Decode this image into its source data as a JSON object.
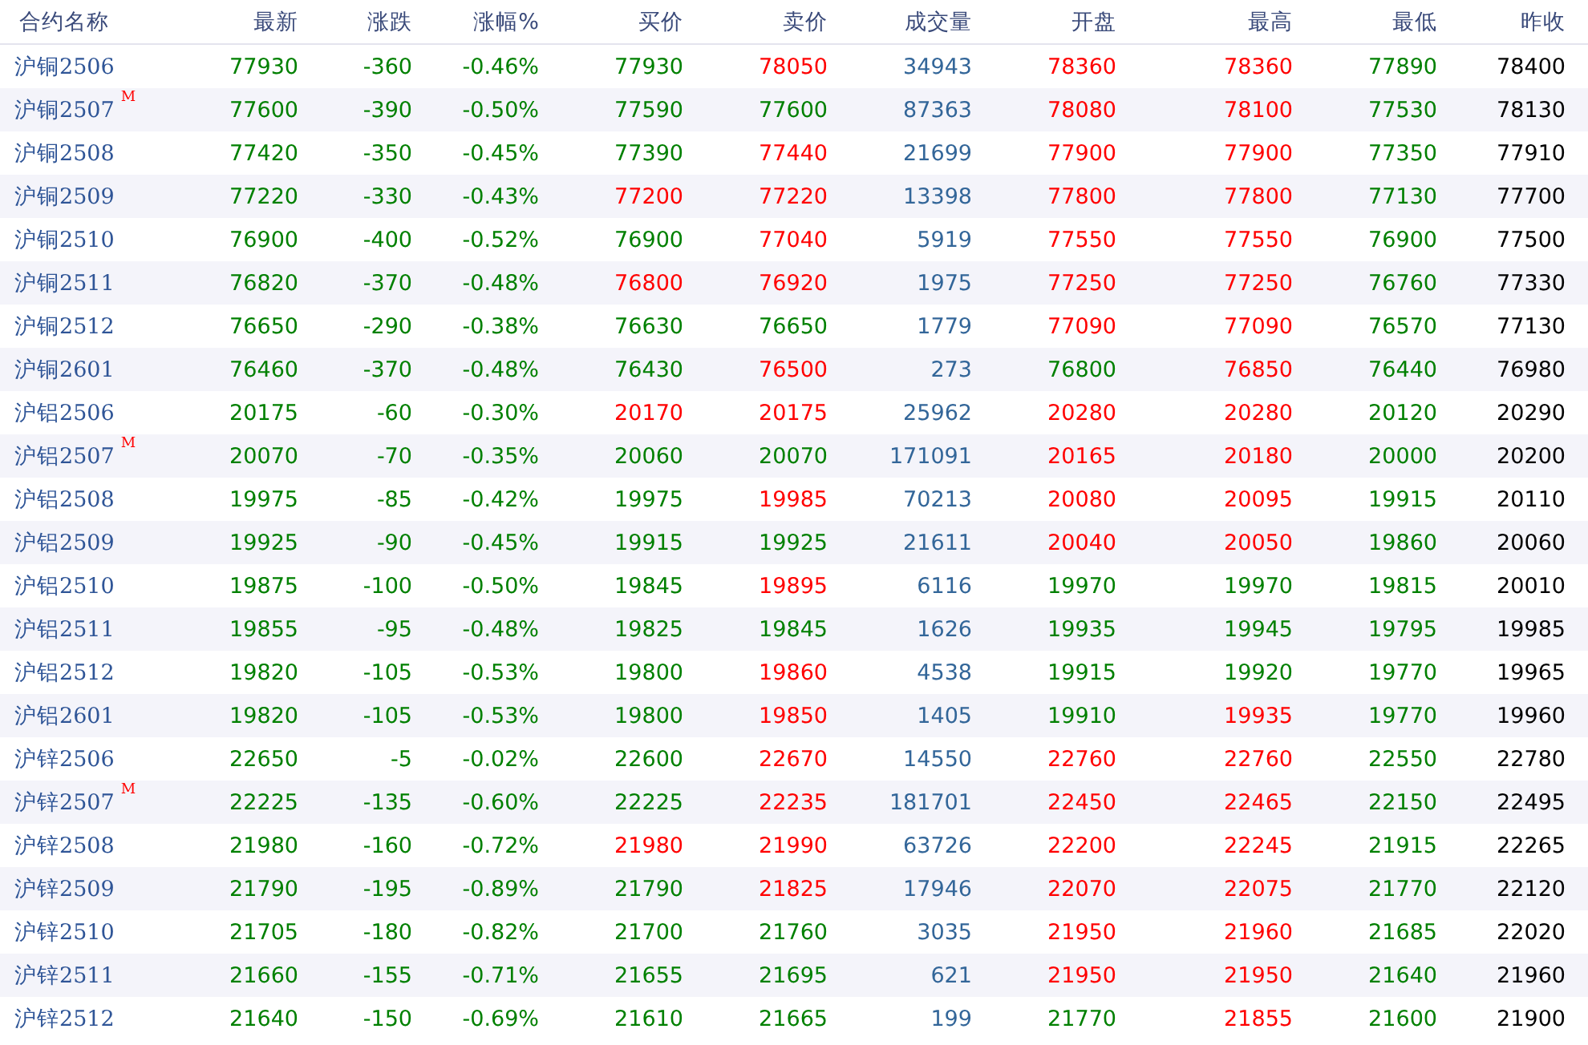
{
  "columns": [
    {
      "label": "合约名称",
      "kind": "name"
    },
    {
      "label": "最新",
      "kind": "trend"
    },
    {
      "label": "涨跌",
      "kind": "trend"
    },
    {
      "label": "涨幅%",
      "kind": "trend"
    },
    {
      "label": "买价",
      "kind": "trend"
    },
    {
      "label": "卖价",
      "kind": "trend"
    },
    {
      "label": "成交量",
      "kind": "volume"
    },
    {
      "label": "开盘",
      "kind": "trend"
    },
    {
      "label": "最高",
      "kind": "trend"
    },
    {
      "label": "最低",
      "kind": "trend"
    },
    {
      "label": "昨收",
      "kind": "plain"
    }
  ],
  "rows": [
    {
      "name": "沪铜2506",
      "cells": [
        {
          "text": "77930",
          "rising": false
        },
        {
          "text": "-360",
          "rising": false
        },
        {
          "text": "-0.46%",
          "rising": false
        },
        {
          "text": "77930",
          "rising": false
        },
        {
          "text": "78050",
          "rising": true
        },
        {
          "text": "34943"
        },
        {
          "text": "78360",
          "rising": true
        },
        {
          "text": "78360",
          "rising": true
        },
        {
          "text": "77890",
          "rising": false
        },
        {
          "text": "78400"
        }
      ]
    },
    {
      "name": "沪铜2507",
      "badge": "M",
      "cells": [
        {
          "text": "77600",
          "rising": false
        },
        {
          "text": "-390",
          "rising": false
        },
        {
          "text": "-0.50%",
          "rising": false
        },
        {
          "text": "77590",
          "rising": false
        },
        {
          "text": "77600",
          "rising": false
        },
        {
          "text": "87363"
        },
        {
          "text": "78080",
          "rising": true
        },
        {
          "text": "78100",
          "rising": true
        },
        {
          "text": "77530",
          "rising": false
        },
        {
          "text": "78130"
        }
      ]
    },
    {
      "name": "沪铜2508",
      "cells": [
        {
          "text": "77420",
          "rising": false
        },
        {
          "text": "-350",
          "rising": false
        },
        {
          "text": "-0.45%",
          "rising": false
        },
        {
          "text": "77390",
          "rising": false
        },
        {
          "text": "77440",
          "rising": true
        },
        {
          "text": "21699"
        },
        {
          "text": "77900",
          "rising": true
        },
        {
          "text": "77900",
          "rising": true
        },
        {
          "text": "77350",
          "rising": false
        },
        {
          "text": "77910"
        }
      ]
    },
    {
      "name": "沪铜2509",
      "cells": [
        {
          "text": "77220",
          "rising": false
        },
        {
          "text": "-330",
          "rising": false
        },
        {
          "text": "-0.43%",
          "rising": false
        },
        {
          "text": "77200",
          "rising": true
        },
        {
          "text": "77220",
          "rising": true
        },
        {
          "text": "13398"
        },
        {
          "text": "77800",
          "rising": true
        },
        {
          "text": "77800",
          "rising": true
        },
        {
          "text": "77130",
          "rising": false
        },
        {
          "text": "77700"
        }
      ]
    },
    {
      "name": "沪铜2510",
      "cells": [
        {
          "text": "76900",
          "rising": false
        },
        {
          "text": "-400",
          "rising": false
        },
        {
          "text": "-0.52%",
          "rising": false
        },
        {
          "text": "76900",
          "rising": false
        },
        {
          "text": "77040",
          "rising": true
        },
        {
          "text": "5919"
        },
        {
          "text": "77550",
          "rising": true
        },
        {
          "text": "77550",
          "rising": true
        },
        {
          "text": "76900",
          "rising": false
        },
        {
          "text": "77500"
        }
      ]
    },
    {
      "name": "沪铜2511",
      "cells": [
        {
          "text": "76820",
          "rising": false
        },
        {
          "text": "-370",
          "rising": false
        },
        {
          "text": "-0.48%",
          "rising": false
        },
        {
          "text": "76800",
          "rising": true
        },
        {
          "text": "76920",
          "rising": true
        },
        {
          "text": "1975"
        },
        {
          "text": "77250",
          "rising": true
        },
        {
          "text": "77250",
          "rising": true
        },
        {
          "text": "76760",
          "rising": false
        },
        {
          "text": "77330"
        }
      ]
    },
    {
      "name": "沪铜2512",
      "cells": [
        {
          "text": "76650",
          "rising": false
        },
        {
          "text": "-290",
          "rising": false
        },
        {
          "text": "-0.38%",
          "rising": false
        },
        {
          "text": "76630",
          "rising": false
        },
        {
          "text": "76650",
          "rising": false
        },
        {
          "text": "1779"
        },
        {
          "text": "77090",
          "rising": true
        },
        {
          "text": "77090",
          "rising": true
        },
        {
          "text": "76570",
          "rising": false
        },
        {
          "text": "77130"
        }
      ]
    },
    {
      "name": "沪铜2601",
      "cells": [
        {
          "text": "76460",
          "rising": false
        },
        {
          "text": "-370",
          "rising": false
        },
        {
          "text": "-0.48%",
          "rising": false
        },
        {
          "text": "76430",
          "rising": false
        },
        {
          "text": "76500",
          "rising": true
        },
        {
          "text": "273"
        },
        {
          "text": "76800",
          "rising": false
        },
        {
          "text": "76850",
          "rising": true
        },
        {
          "text": "76440",
          "rising": false
        },
        {
          "text": "76980"
        }
      ]
    },
    {
      "name": "沪铝2506",
      "cells": [
        {
          "text": "20175",
          "rising": false
        },
        {
          "text": "-60",
          "rising": false
        },
        {
          "text": "-0.30%",
          "rising": false
        },
        {
          "text": "20170",
          "rising": true
        },
        {
          "text": "20175",
          "rising": true
        },
        {
          "text": "25962"
        },
        {
          "text": "20280",
          "rising": true
        },
        {
          "text": "20280",
          "rising": true
        },
        {
          "text": "20120",
          "rising": false
        },
        {
          "text": "20290"
        }
      ]
    },
    {
      "name": "沪铝2507",
      "badge": "M",
      "cells": [
        {
          "text": "20070",
          "rising": false
        },
        {
          "text": "-70",
          "rising": false
        },
        {
          "text": "-0.35%",
          "rising": false
        },
        {
          "text": "20060",
          "rising": false
        },
        {
          "text": "20070",
          "rising": false
        },
        {
          "text": "171091"
        },
        {
          "text": "20165",
          "rising": true
        },
        {
          "text": "20180",
          "rising": true
        },
        {
          "text": "20000",
          "rising": false
        },
        {
          "text": "20200"
        }
      ]
    },
    {
      "name": "沪铝2508",
      "cells": [
        {
          "text": "19975",
          "rising": false
        },
        {
          "text": "-85",
          "rising": false
        },
        {
          "text": "-0.42%",
          "rising": false
        },
        {
          "text": "19975",
          "rising": false
        },
        {
          "text": "19985",
          "rising": true
        },
        {
          "text": "70213"
        },
        {
          "text": "20080",
          "rising": true
        },
        {
          "text": "20095",
          "rising": true
        },
        {
          "text": "19915",
          "rising": false
        },
        {
          "text": "20110"
        }
      ]
    },
    {
      "name": "沪铝2509",
      "cells": [
        {
          "text": "19925",
          "rising": false
        },
        {
          "text": "-90",
          "rising": false
        },
        {
          "text": "-0.45%",
          "rising": false
        },
        {
          "text": "19915",
          "rising": false
        },
        {
          "text": "19925",
          "rising": false
        },
        {
          "text": "21611"
        },
        {
          "text": "20040",
          "rising": true
        },
        {
          "text": "20050",
          "rising": true
        },
        {
          "text": "19860",
          "rising": false
        },
        {
          "text": "20060"
        }
      ]
    },
    {
      "name": "沪铝2510",
      "cells": [
        {
          "text": "19875",
          "rising": false
        },
        {
          "text": "-100",
          "rising": false
        },
        {
          "text": "-0.50%",
          "rising": false
        },
        {
          "text": "19845",
          "rising": false
        },
        {
          "text": "19895",
          "rising": true
        },
        {
          "text": "6116"
        },
        {
          "text": "19970",
          "rising": false
        },
        {
          "text": "19970",
          "rising": false
        },
        {
          "text": "19815",
          "rising": false
        },
        {
          "text": "20010"
        }
      ]
    },
    {
      "name": "沪铝2511",
      "cells": [
        {
          "text": "19855",
          "rising": false
        },
        {
          "text": "-95",
          "rising": false
        },
        {
          "text": "-0.48%",
          "rising": false
        },
        {
          "text": "19825",
          "rising": false
        },
        {
          "text": "19845",
          "rising": false
        },
        {
          "text": "1626"
        },
        {
          "text": "19935",
          "rising": false
        },
        {
          "text": "19945",
          "rising": false
        },
        {
          "text": "19795",
          "rising": false
        },
        {
          "text": "19985"
        }
      ]
    },
    {
      "name": "沪铝2512",
      "cells": [
        {
          "text": "19820",
          "rising": false
        },
        {
          "text": "-105",
          "rising": false
        },
        {
          "text": "-0.53%",
          "rising": false
        },
        {
          "text": "19800",
          "rising": false
        },
        {
          "text": "19860",
          "rising": true
        },
        {
          "text": "4538"
        },
        {
          "text": "19915",
          "rising": false
        },
        {
          "text": "19920",
          "rising": false
        },
        {
          "text": "19770",
          "rising": false
        },
        {
          "text": "19965"
        }
      ]
    },
    {
      "name": "沪铝2601",
      "cells": [
        {
          "text": "19820",
          "rising": false
        },
        {
          "text": "-105",
          "rising": false
        },
        {
          "text": "-0.53%",
          "rising": false
        },
        {
          "text": "19800",
          "rising": false
        },
        {
          "text": "19850",
          "rising": true
        },
        {
          "text": "1405"
        },
        {
          "text": "19910",
          "rising": false
        },
        {
          "text": "19935",
          "rising": true
        },
        {
          "text": "19770",
          "rising": false
        },
        {
          "text": "19960"
        }
      ]
    },
    {
      "name": "沪锌2506",
      "cells": [
        {
          "text": "22650",
          "rising": false
        },
        {
          "text": "-5",
          "rising": false
        },
        {
          "text": "-0.02%",
          "rising": false
        },
        {
          "text": "22600",
          "rising": false
        },
        {
          "text": "22670",
          "rising": true
        },
        {
          "text": "14550"
        },
        {
          "text": "22760",
          "rising": true
        },
        {
          "text": "22760",
          "rising": true
        },
        {
          "text": "22550",
          "rising": false
        },
        {
          "text": "22780"
        }
      ]
    },
    {
      "name": "沪锌2507",
      "badge": "M",
      "cells": [
        {
          "text": "22225",
          "rising": false
        },
        {
          "text": "-135",
          "rising": false
        },
        {
          "text": "-0.60%",
          "rising": false
        },
        {
          "text": "22225",
          "rising": false
        },
        {
          "text": "22235",
          "rising": true
        },
        {
          "text": "181701"
        },
        {
          "text": "22450",
          "rising": true
        },
        {
          "text": "22465",
          "rising": true
        },
        {
          "text": "22150",
          "rising": false
        },
        {
          "text": "22495"
        }
      ]
    },
    {
      "name": "沪锌2508",
      "cells": [
        {
          "text": "21980",
          "rising": false
        },
        {
          "text": "-160",
          "rising": false
        },
        {
          "text": "-0.72%",
          "rising": false
        },
        {
          "text": "21980",
          "rising": true
        },
        {
          "text": "21990",
          "rising": true
        },
        {
          "text": "63726"
        },
        {
          "text": "22200",
          "rising": true
        },
        {
          "text": "22245",
          "rising": true
        },
        {
          "text": "21915",
          "rising": false
        },
        {
          "text": "22265"
        }
      ]
    },
    {
      "name": "沪锌2509",
      "cells": [
        {
          "text": "21790",
          "rising": false
        },
        {
          "text": "-195",
          "rising": false
        },
        {
          "text": "-0.89%",
          "rising": false
        },
        {
          "text": "21790",
          "rising": false
        },
        {
          "text": "21825",
          "rising": true
        },
        {
          "text": "17946"
        },
        {
          "text": "22070",
          "rising": true
        },
        {
          "text": "22075",
          "rising": true
        },
        {
          "text": "21770",
          "rising": false
        },
        {
          "text": "22120"
        }
      ]
    },
    {
      "name": "沪锌2510",
      "cells": [
        {
          "text": "21705",
          "rising": false
        },
        {
          "text": "-180",
          "rising": false
        },
        {
          "text": "-0.82%",
          "rising": false
        },
        {
          "text": "21700",
          "rising": false
        },
        {
          "text": "21760",
          "rising": false
        },
        {
          "text": "3035"
        },
        {
          "text": "21950",
          "rising": true
        },
        {
          "text": "21960",
          "rising": true
        },
        {
          "text": "21685",
          "rising": false
        },
        {
          "text": "22020"
        }
      ]
    },
    {
      "name": "沪锌2511",
      "cells": [
        {
          "text": "21660",
          "rising": false
        },
        {
          "text": "-155",
          "rising": false
        },
        {
          "text": "-0.71%",
          "rising": false
        },
        {
          "text": "21655",
          "rising": false
        },
        {
          "text": "21695",
          "rising": false
        },
        {
          "text": "621"
        },
        {
          "text": "21950",
          "rising": true
        },
        {
          "text": "21950",
          "rising": true
        },
        {
          "text": "21640",
          "rising": false
        },
        {
          "text": "21960"
        }
      ]
    },
    {
      "name": "沪锌2512",
      "cells": [
        {
          "text": "21640",
          "rising": false
        },
        {
          "text": "-150",
          "rising": false
        },
        {
          "text": "-0.69%",
          "rising": false
        },
        {
          "text": "21610",
          "rising": false
        },
        {
          "text": "21665",
          "rising": false
        },
        {
          "text": "199"
        },
        {
          "text": "21770",
          "rising": false
        },
        {
          "text": "21855",
          "rising": true
        },
        {
          "text": "21600",
          "rising": false
        },
        {
          "text": "21900"
        }
      ]
    }
  ]
}
